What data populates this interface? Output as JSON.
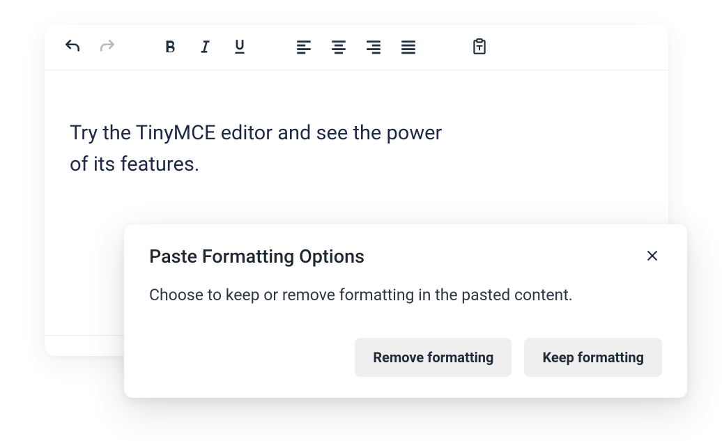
{
  "editor": {
    "content": "Try the TinyMCE editor and see the power of its features."
  },
  "dialog": {
    "title": "Paste Formatting Options",
    "body": "Choose to keep or remove formatting in the pasted content.",
    "remove_label": "Remove formatting",
    "keep_label": "Keep formatting"
  }
}
